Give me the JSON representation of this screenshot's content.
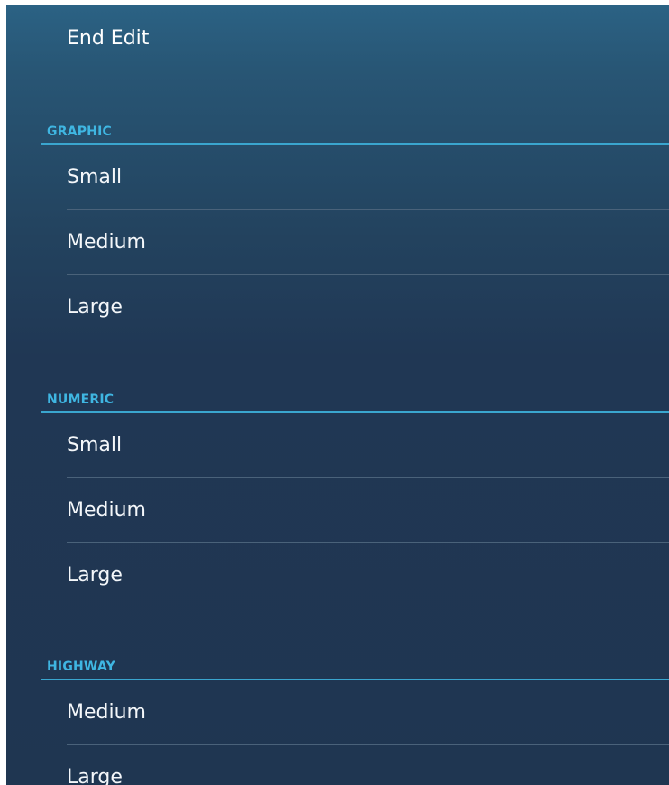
{
  "end_edit_label": "End Edit",
  "sections": [
    {
      "title": "GRAPHIC",
      "items": [
        {
          "label": "Small"
        },
        {
          "label": "Medium"
        },
        {
          "label": "Large"
        }
      ]
    },
    {
      "title": "NUMERIC",
      "items": [
        {
          "label": "Small"
        },
        {
          "label": "Medium"
        },
        {
          "label": "Large"
        }
      ]
    },
    {
      "title": "HIGHWAY",
      "items": [
        {
          "label": "Medium"
        },
        {
          "label": "Large"
        }
      ]
    }
  ],
  "colors": {
    "section_accent": "#3fb6e2",
    "background_top": "#2b6284",
    "background_bottom": "#1f3651"
  }
}
